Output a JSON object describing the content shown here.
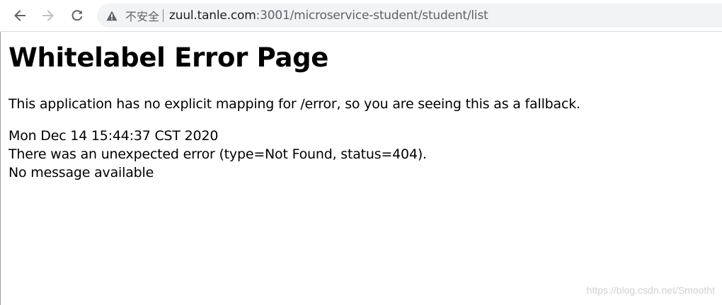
{
  "browser": {
    "security_label": "不安全",
    "url_host": "zuul.tanle.com",
    "url_path": ":3001/microservice-student/student/list",
    "icons": {
      "back": "arrow-left-icon",
      "forward": "arrow-right-icon",
      "reload": "reload-icon",
      "security": "warning-triangle-icon"
    }
  },
  "page": {
    "title": "Whitelabel Error Page",
    "description": "This application has no explicit mapping for /error, so you are seeing this as a fallback.",
    "timestamp": "Mon Dec 14 15:44:37 CST 2020",
    "error_line": "There was an unexpected error (type=Not Found, status=404).",
    "message": "No message available"
  },
  "watermark": "https://blog.csdn.net/Smootht"
}
